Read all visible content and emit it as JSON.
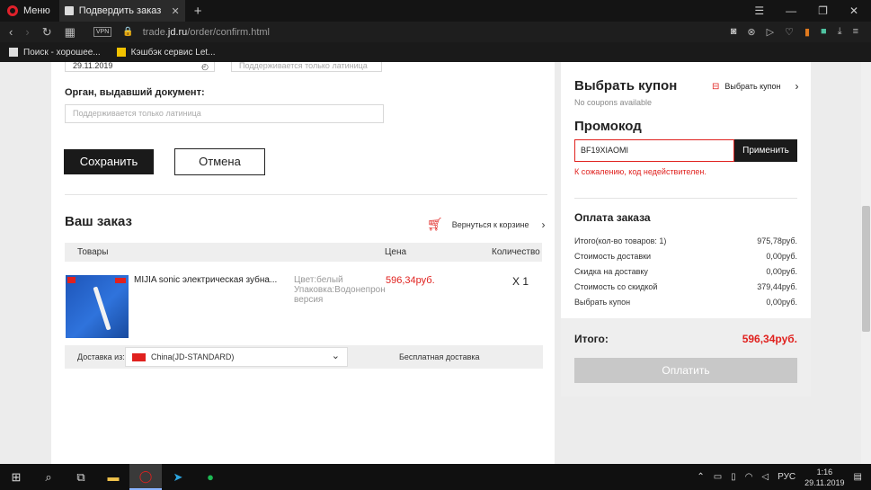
{
  "browser": {
    "menu_label": "Меню",
    "tab_title": "Подвердить заказ",
    "url_prefix": "trade.",
    "url_domain": "jd.ru",
    "url_path": "/order/confirm.html",
    "vpn_label": "VPN",
    "bookmarks": [
      "Поиск - хорошее...",
      "Кэшбэк сервис Let..."
    ]
  },
  "form": {
    "date_value": "29.11.2019",
    "latin_hint_top": "Поддерживается только латиница",
    "issuer_label": "Орган, выдавший документ:",
    "issuer_placeholder": "Поддерживается только латиница",
    "save_label": "Сохранить",
    "cancel_label": "Отмена"
  },
  "order": {
    "title": "Ваш заказ",
    "back_to_cart": "Вернуться к корзине",
    "columns": {
      "goods": "Товары",
      "price": "Цена",
      "qty": "Количество"
    },
    "product": {
      "name": "MIJIA sonic электрическая зубна...",
      "color": "Цвет:белый",
      "package": "Упаковка:Водонепрон",
      "version": "версия",
      "price": "596,34руб.",
      "qty": "X 1"
    },
    "shipping": {
      "from_label": "Доставка из:",
      "warehouse": "China(JD-STANDARD)",
      "free_label": "Бесплатная доставка"
    }
  },
  "coupon": {
    "title": "Выбрать купон",
    "link_label": "Выбрать купон",
    "none_text": "No coupons available"
  },
  "promo": {
    "title": "Промокод",
    "value": "BF19XIAOMI",
    "apply_label": "Применить",
    "error": "К сожалению, код недействителен."
  },
  "payment": {
    "title": "Оплата заказа",
    "rows": [
      {
        "label": "Итого(кол-во товаров: 1)",
        "value": "975,78руб."
      },
      {
        "label": "Стоимость доставки",
        "value": "0,00руб."
      },
      {
        "label": "Скидка на доставку",
        "value": "0,00руб."
      },
      {
        "label": "Стоимость со скидкой",
        "value": "379,44руб."
      },
      {
        "label": "Выбрать купон",
        "value": "0,00руб."
      }
    ],
    "total_label": "Итого:",
    "total_value": "596,34руб.",
    "pay_label": "Оплатить"
  },
  "taskbar": {
    "lang": "РУС",
    "time": "1:16",
    "date": "29.11.2019"
  },
  "colors": {
    "accent": "#e0211e",
    "dark": "#1a1a1a"
  }
}
